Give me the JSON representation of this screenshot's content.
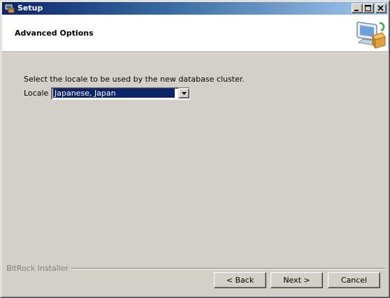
{
  "window": {
    "title": "Setup",
    "icons": [
      "setup-app-icon",
      "minimize-icon",
      "maximize-icon",
      "close-icon"
    ]
  },
  "header": {
    "title": "Advanced Options",
    "icon": "computer-package-icon"
  },
  "content": {
    "description": "Select the locale to be used by the new database cluster.",
    "locale_label": "Locale",
    "locale_value": "Japanese, Japan"
  },
  "footer": {
    "installer_label": "BitRock Installer",
    "back_label": "< Back",
    "next_label": "Next >",
    "cancel_label": "Cancel"
  },
  "colors": {
    "titlebar_start": "#0a246a",
    "titlebar_end": "#a6caf0",
    "face": "#d4d0c8",
    "selection": "#0a246a"
  }
}
